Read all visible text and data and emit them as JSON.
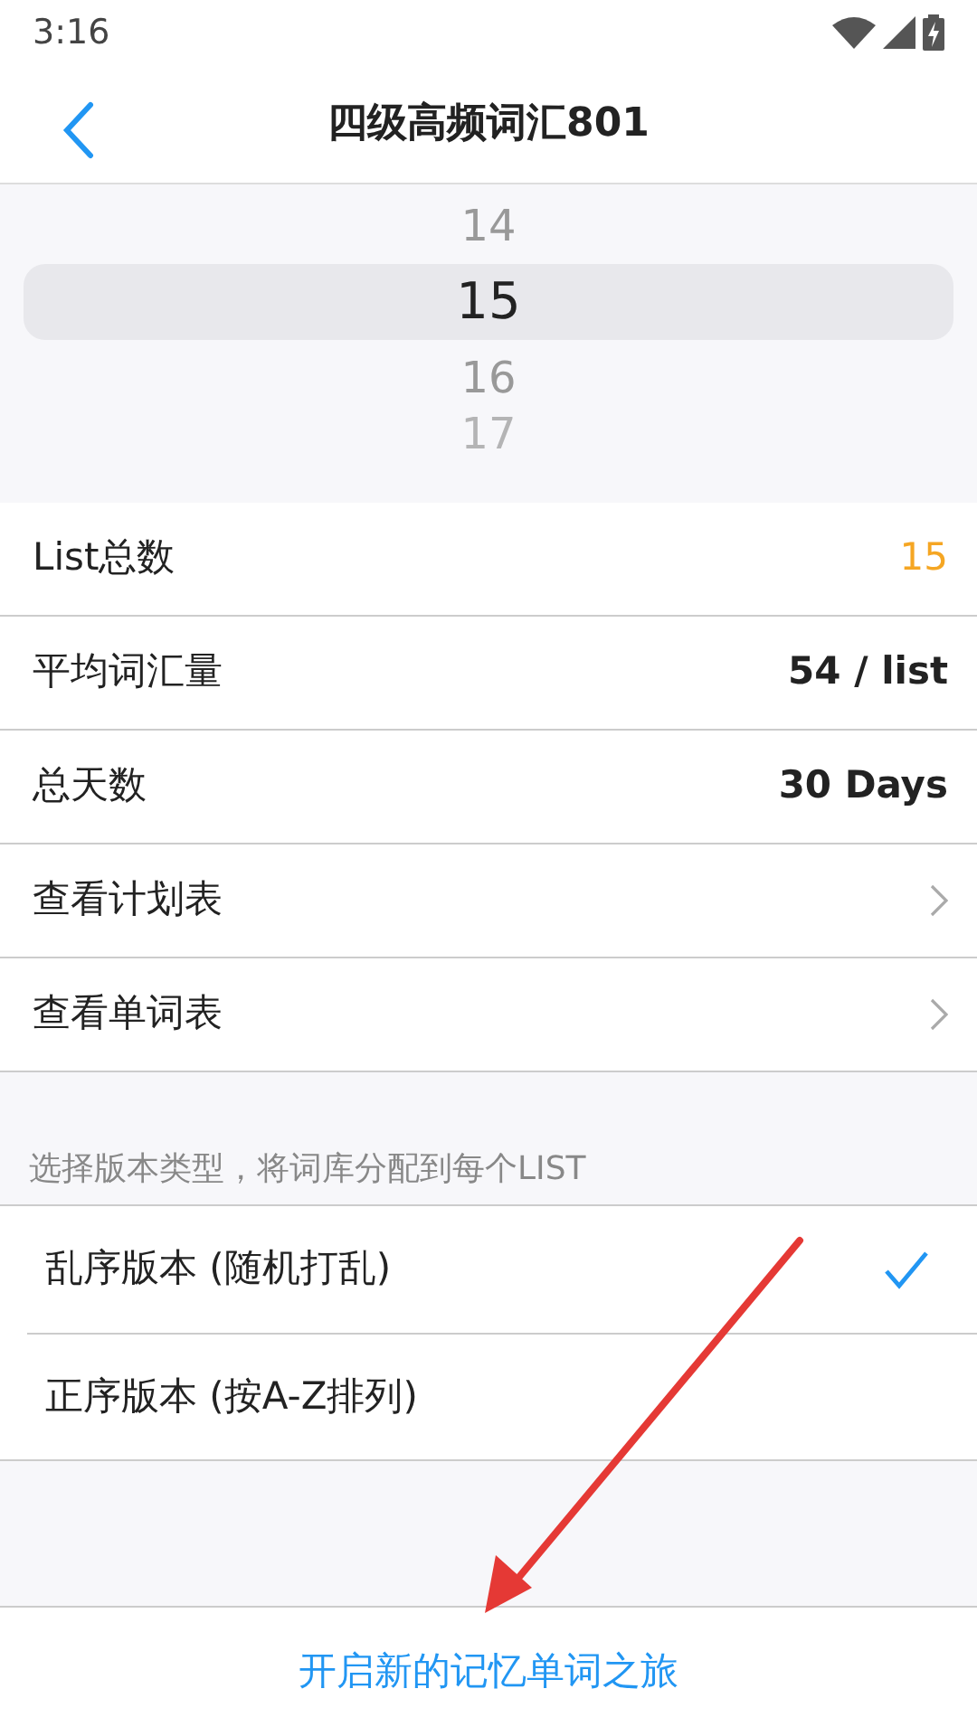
{
  "status_bar": {
    "time": "3:16"
  },
  "header": {
    "title": "四级高频词汇801"
  },
  "picker": [
    {
      "label": "14",
      "selected": false
    },
    {
      "label": "15",
      "selected": true
    },
    {
      "label": "16",
      "selected": false
    },
    {
      "label": "17",
      "selected": false
    }
  ],
  "stats": [
    {
      "kind": "value",
      "label": "List总数",
      "value": "15",
      "accent": true
    },
    {
      "kind": "value",
      "label": "平均词汇量",
      "value": "54 / list",
      "accent": false
    },
    {
      "kind": "value",
      "label": "总天数",
      "value": "30 Days",
      "accent": false
    },
    {
      "kind": "link",
      "label": "查看计划表"
    },
    {
      "kind": "link",
      "label": "查看单词表"
    }
  ],
  "version_section": {
    "caption": "选择版本类型，将词库分配到每个LIST",
    "options": [
      {
        "label": "乱序版本 (随机打乱)",
        "selected": true
      },
      {
        "label": "正序版本 (按A-Z排列)",
        "selected": false
      }
    ]
  },
  "start_button": {
    "label": "开启新的记忆单词之旅"
  }
}
